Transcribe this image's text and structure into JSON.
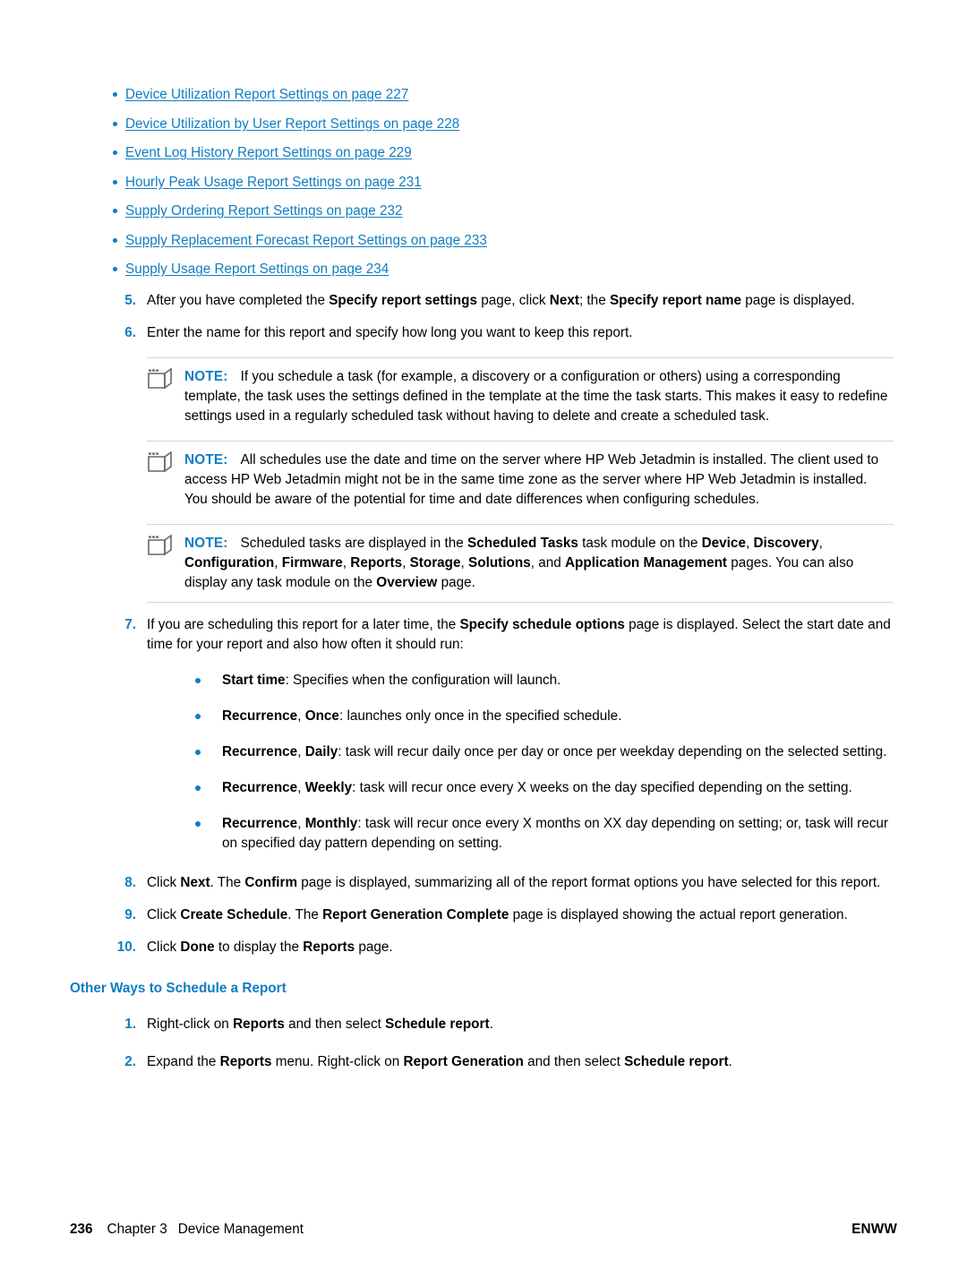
{
  "links": [
    "Device Utilization Report Settings on page 227",
    "Device Utilization by User Report Settings on page 228",
    "Event Log History Report Settings on page 229",
    "Hourly Peak Usage Report Settings on page 231",
    "Supply Ordering Report Settings on page 232",
    "Supply Replacement Forecast Report Settings on page 233",
    "Supply Usage Report Settings on page 234"
  ],
  "steps": {
    "s5_num": "5.",
    "s5_a": "After you have completed the ",
    "s5_b1": "Specify report settings",
    "s5_c": " page, click ",
    "s5_b2": "Next",
    "s5_d": "; the ",
    "s5_b3": "Specify report name",
    "s5_e": " page is displayed.",
    "s6_num": "6.",
    "s6_text": "Enter the name for this report and specify how long you want to keep this report.",
    "s7_num": "7.",
    "s7_a": "If you are scheduling this report for a later time, the ",
    "s7_b1": "Specify schedule options",
    "s7_c": " page is displayed. Select the start date and time for your report and also how often it should run:",
    "s8_num": "8.",
    "s8_a": "Click ",
    "s8_b1": "Next",
    "s8_c": ". The ",
    "s8_b2": "Confirm",
    "s8_d": " page is displayed, summarizing all of the report format options you have selected for this report.",
    "s9_num": "9.",
    "s9_a": "Click ",
    "s9_b1": "Create Schedule",
    "s9_c": ". The ",
    "s9_b2": "Report Generation Complete",
    "s9_d": " page is displayed showing the actual report generation.",
    "s10_num": "10.",
    "s10_a": "Click ",
    "s10_b1": "Done",
    "s10_c": " to display the ",
    "s10_b2": "Reports",
    "s10_d": " page."
  },
  "notes": {
    "label": "NOTE:",
    "note1": "If you schedule a task (for example, a discovery or a configuration or others) using a corresponding template, the task uses the settings defined in the template at the time the task starts. This makes it easy to redefine settings used in a regularly scheduled task without having to delete and create a scheduled task.",
    "note2": "All schedules use the date and time on the server where HP Web Jetadmin is installed. The client used to access HP Web Jetadmin might not be in the same time zone as the server where HP Web Jetadmin is installed. You should be aware of the potential for time and date differences when configuring schedules.",
    "note3": {
      "a": "Scheduled tasks are displayed in the ",
      "b1": "Scheduled Tasks",
      "c": " task module on the ",
      "b2": "Device",
      "d": ", ",
      "b3": "Discovery",
      "e": ", ",
      "b4": "Configuration",
      "f": ", ",
      "b5": "Firmware",
      "g": ", ",
      "b6": "Reports",
      "h": ", ",
      "b7": "Storage",
      "i": ", ",
      "b8": "Solutions",
      "j": ", and ",
      "b9": "Application Management",
      "k": " pages. You can also display any task module on the ",
      "b10": "Overview",
      "l": " page."
    }
  },
  "recurrence": [
    {
      "bold": "Start time",
      "rest": ": Specifies when the configuration will launch."
    },
    {
      "bold": "Recurrence",
      "mid": ", ",
      "bold2": "Once",
      "rest": ": launches only once in the specified schedule."
    },
    {
      "bold": "Recurrence",
      "mid": ", ",
      "bold2": "Daily",
      "rest": ": task will recur daily once per day or once per weekday depending on the selected setting."
    },
    {
      "bold": "Recurrence",
      "mid": ", ",
      "bold2": "Weekly",
      "rest": ": task will recur once every X weeks on the day specified depending on the setting."
    },
    {
      "bold": "Recurrence",
      "mid": ", ",
      "bold2": "Monthly",
      "rest": ": task will recur once every X months on XX day depending on setting; or, task will recur on specified day pattern depending on setting."
    }
  ],
  "other_ways": {
    "heading": "Other Ways to Schedule a Report",
    "o1_num": "1.",
    "o1_a": "Right-click on ",
    "o1_b1": "Reports",
    "o1_c": " and then select ",
    "o1_b2": "Schedule report",
    "o1_d": ".",
    "o2_num": "2.",
    "o2_a": "Expand the ",
    "o2_b1": "Reports",
    "o2_c": " menu. Right-click on ",
    "o2_b2": "Report Generation",
    "o2_d": " and then select ",
    "o2_b3": "Schedule report",
    "o2_e": "."
  },
  "footer": {
    "page_number": "236",
    "chapter_label": "Chapter 3",
    "chapter_title": "Device Management",
    "locale": "ENWW"
  },
  "colors": {
    "accent": "#0f7dc2",
    "rule": "#bfd9ea"
  }
}
